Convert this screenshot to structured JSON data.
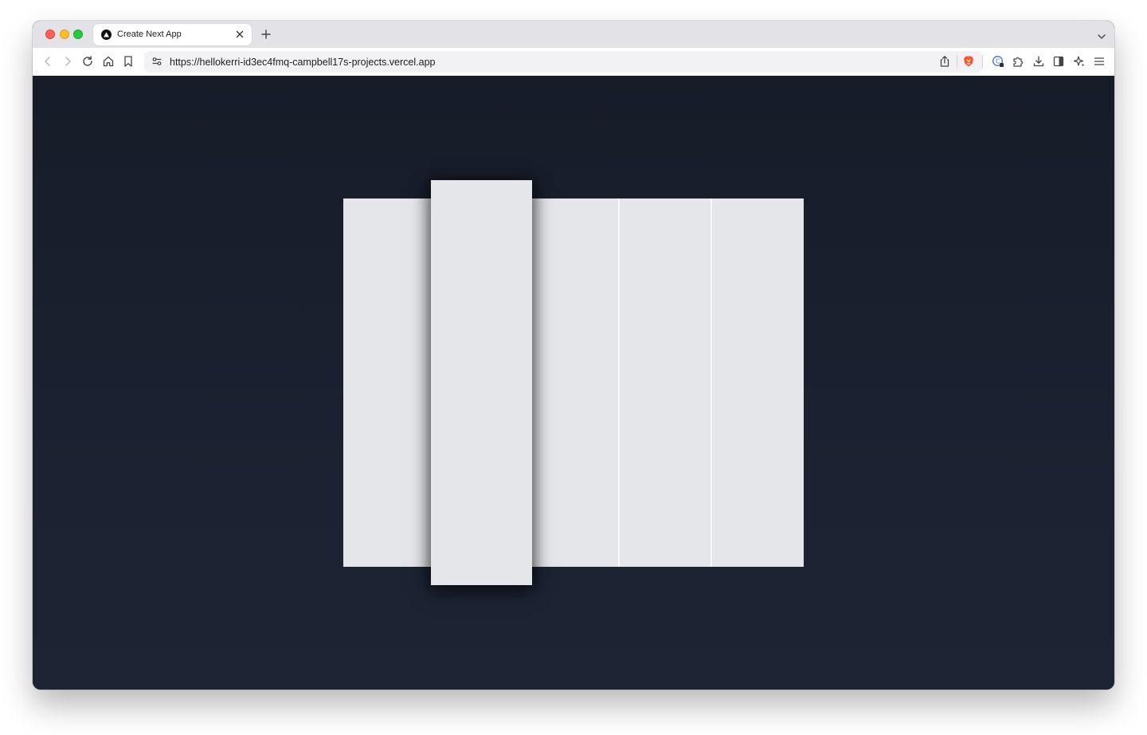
{
  "browser": {
    "tab": {
      "title": "Create Next App",
      "favicon": "vercel-triangle-icon"
    },
    "new_tab_icon": "plus-icon",
    "tab_list_icon": "chevron-down-icon",
    "toolbar": {
      "back_icon": "back-arrow-icon",
      "forward_icon": "forward-arrow-icon",
      "reload_icon": "reload-icon",
      "home_icon": "home-icon",
      "bookmark_icon": "bookmark-icon",
      "site_settings_icon": "site-settings-icon",
      "url": "https://hellokerri-id3ec4fmq-campbell17s-projects.vercel.app",
      "share_icon": "share-icon",
      "brave_shields_icon": "brave-lion-icon",
      "wallet_icon": "wallet-icon",
      "extensions_icon": "puzzle-icon",
      "downloads_icon": "download-icon",
      "sidebar_icon": "sidebar-icon",
      "leo_icon": "sparkle-icon",
      "menu_icon": "hamburger-menu-icon"
    }
  },
  "page": {
    "background_color": "#1b2130",
    "panels": [
      {
        "name": "panel-1",
        "raised": false
      },
      {
        "name": "panel-2",
        "raised": true
      },
      {
        "name": "panel-3",
        "raised": false
      },
      {
        "name": "panel-4",
        "raised": false
      },
      {
        "name": "panel-5",
        "raised": false
      }
    ],
    "panel_color": "#e5e6ea"
  }
}
